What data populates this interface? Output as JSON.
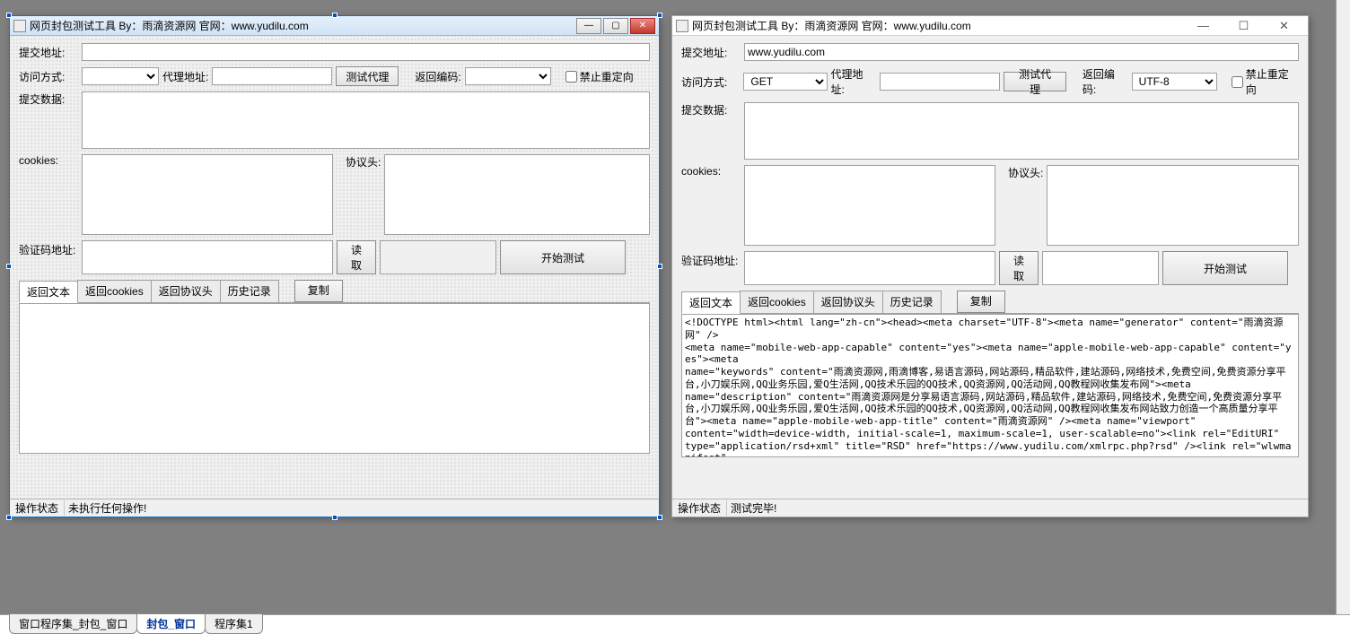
{
  "appTitle": "网页封包测试工具  By：雨滴资源网  官网：www.yudilu.com",
  "labels": {
    "addr": "提交地址:",
    "method": "访问方式:",
    "proxy": "代理地址:",
    "testProxy": "测试代理",
    "retEnc": "返回编码:",
    "noRedirect": "禁止重定向",
    "postData": "提交数据:",
    "cookies": "cookies:",
    "headers": "协议头:",
    "captchaAddr": "验证码地址:",
    "read": "读取",
    "startTest": "开始测试",
    "copy": "复制"
  },
  "tabs": {
    "retText": "返回文本",
    "retCookies": "返回cookies",
    "retHeaders": "返回协议头",
    "history": "历史记录"
  },
  "status": {
    "label": "操作状态",
    "leftText": "未执行任何操作!",
    "rightText": "测试完毕!"
  },
  "rightValues": {
    "addr": "www.yudilu.com",
    "method": "GET",
    "enc": "UTF-8"
  },
  "leftValues": {
    "addr": "",
    "method": "",
    "proxy": "",
    "enc": ""
  },
  "resultHtml": "<!DOCTYPE html><html lang=\"zh-cn\"><head><meta charset=\"UTF-8\"><meta name=\"generator\" content=\"雨滴资源网\" />\n<meta name=\"mobile-web-app-capable\" content=\"yes\"><meta name=\"apple-mobile-web-app-capable\" content=\"yes\"><meta\nname=\"keywords\" content=\"雨滴资源网,雨滴博客,易语言源码,网站源码,精品软件,建站源码,网络技术,免费空间,免费资源分享平台,小刀娱乐网,QQ业务乐园,爱Q生活网,QQ技术乐园的QQ技术,QQ资源网,QQ活动网,QQ教程网收集发布网\"><meta\nname=\"description\" content=\"雨滴资源网是分享易语言源码,网站源码,精品软件,建站源码,网络技术,免费空间,免费资源分享平台,小刀娱乐网,QQ业务乐园,爱Q生活网,QQ技术乐园的QQ技术,QQ资源网,QQ活动网,QQ教程网收集发布网站致力创造一个高质量分享平台\"><meta name=\"apple-mobile-web-app-title\" content=\"雨滴资源网\" /><meta name=\"viewport\"\ncontent=\"width=device-width, initial-scale=1, maximum-scale=1, user-scalable=no\"><link rel=\"EditURI\"\ntype=\"application/rsd+xml\" title=\"RSD\" href=\"https://www.yudilu.com/xmlrpc.php?rsd\" /><link rel=\"wlwmanifest\"\ntype=\"application/wlwmanifest+xml\" href=\"https://www.yudilu.com/wlwmanifest.xml\" /><link rel=\"alternate\"\ntype=\"application/rss+xml\" title=\"RSS\" href=\"https://www.yudilu.com/rss.php\" /><link rel=\"shortcut icon\"\nhref=\"https://www.yudilu.com/favicon.ico\"><title>雨滴资源网-专注分享各种精品软件,网站源码,易语言源码</title>\n<link rel=\"stylesheet\" href=\"https://www.yudilu.com/content/templates/FLY/css/font-awesome.min.css\ntype=\"text/css\" media=\"all\" /><link rel=\"stylesheet\"",
  "bottomTabs": {
    "t1": "窗口程序集_封包_窗口",
    "t2": "封包_窗口",
    "t3": "程序集1"
  }
}
